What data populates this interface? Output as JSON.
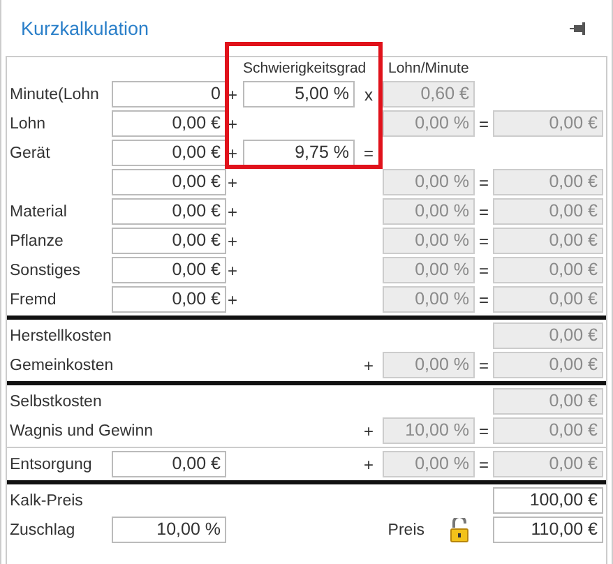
{
  "title": "Kurzkalkulation",
  "headers": {
    "difficulty": "Schwierigkeitsgrad",
    "wage": "Lohn/Minute"
  },
  "highlight_difficulty": true,
  "sections": [
    {
      "rule_below": {
        "heavy": true
      },
      "rows": [
        {
          "label": "Minute(Lohn",
          "amount": {
            "value": "0",
            "disabled": false
          },
          "op1": "+",
          "difficulty": {
            "value": "5,00 %",
            "disabled": false
          },
          "op2": "x",
          "percent": {
            "value": "0,60 €",
            "disabled": true
          }
        },
        {
          "label": "Lohn",
          "amount": {
            "value": "0,00 €",
            "disabled": false
          },
          "op1": "+",
          "percent": {
            "value": "0,00 %",
            "disabled": true
          },
          "op3": "=",
          "result": {
            "value": "0,00 €",
            "disabled": true
          }
        },
        {
          "label": "Gerät",
          "amount": {
            "value": "0,00 €",
            "disabled": false
          },
          "op1": "+",
          "difficulty": {
            "value": "9,75 %",
            "disabled": false
          },
          "op2": "="
        },
        {
          "amount": {
            "value": "0,00 €",
            "disabled": false
          },
          "op1": "+",
          "percent": {
            "value": "0,00 %",
            "disabled": true
          },
          "op3": "=",
          "result": {
            "value": "0,00 €",
            "disabled": true
          }
        },
        {
          "label": "Material",
          "amount": {
            "value": "0,00 €",
            "disabled": false
          },
          "op1": "+",
          "percent": {
            "value": "0,00 %",
            "disabled": true
          },
          "op3": "=",
          "result": {
            "value": "0,00 €",
            "disabled": true
          }
        },
        {
          "label": "Pflanze",
          "amount": {
            "value": "0,00 €",
            "disabled": false
          },
          "op1": "+",
          "percent": {
            "value": "0,00 %",
            "disabled": true
          },
          "op3": "=",
          "result": {
            "value": "0,00 €",
            "disabled": true
          }
        },
        {
          "label": "Sonstiges",
          "amount": {
            "value": "0,00 €",
            "disabled": false
          },
          "op1": "+",
          "percent": {
            "value": "0,00 %",
            "disabled": true
          },
          "op3": "=",
          "result": {
            "value": "0,00 €",
            "disabled": true
          }
        },
        {
          "label": "Fremd",
          "amount": {
            "value": "0,00 €",
            "disabled": false
          },
          "op1": "+",
          "percent": {
            "value": "0,00 %",
            "disabled": true
          },
          "op3": "=",
          "result": {
            "value": "0,00 €",
            "disabled": true
          }
        }
      ]
    },
    {
      "rule_below": {
        "heavy": true
      },
      "rows": [
        {
          "label": "Herstellkosten",
          "result": {
            "value": "0,00 €",
            "disabled": true
          }
        },
        {
          "label": "Gemeinkosten",
          "op2": "+",
          "percent": {
            "value": "0,00 %",
            "disabled": true
          },
          "op3": "=",
          "result": {
            "value": "0,00 €",
            "disabled": true
          }
        }
      ]
    },
    {
      "rule_below": {
        "heavy": false
      },
      "rows": [
        {
          "label": "Selbstkosten",
          "result": {
            "value": "0,00 €",
            "disabled": true
          }
        },
        {
          "label": "Wagnis und Gewinn",
          "op2": "+",
          "percent": {
            "value": "10,00 %",
            "disabled": true
          },
          "op3": "=",
          "result": {
            "value": "0,00 €",
            "disabled": true
          }
        }
      ]
    },
    {
      "rule_below": {
        "heavy": true
      },
      "rows": [
        {
          "label": "Entsorgung",
          "amount": {
            "value": "0,00 €",
            "disabled": false
          },
          "op2": "+",
          "percent": {
            "value": "0,00 %",
            "disabled": true
          },
          "op3": "=",
          "result": {
            "value": "0,00 €",
            "disabled": true
          }
        }
      ]
    },
    {
      "rows": [
        {
          "label": "Kalk-Preis",
          "result": {
            "value": "100,00 €",
            "disabled": false
          }
        },
        {
          "label": "Zuschlag",
          "amount": {
            "value": "10,00 %",
            "disabled": false
          },
          "price_label": "Preis",
          "lock": {
            "locked": false
          },
          "result": {
            "value": "110,00 €",
            "disabled": false
          }
        }
      ]
    }
  ]
}
